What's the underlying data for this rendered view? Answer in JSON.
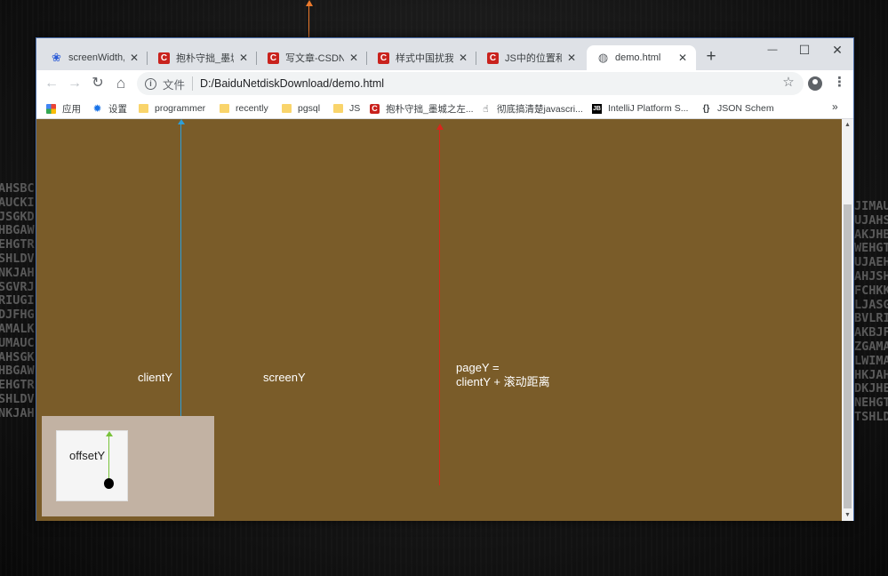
{
  "desktop": {
    "left_letters": [
      "AHSBC",
      "AUCKI",
      "JSGKD",
      "HBGAW",
      "EHGTR",
      "SHLDV",
      "NKJAH",
      "SGVRJ",
      "RIUGI",
      "DJFHG",
      "AMALK",
      "UMAUC",
      "AHSGK",
      "HBGAW",
      "EHGTR",
      "SHLDV",
      "NKJAH"
    ],
    "right_letters": [
      "JIMAU",
      "UJAHS",
      "AKJHB",
      "WEHGT",
      "UJAEH",
      "AHJSH",
      "FCHKK",
      "LJASG",
      "BVLRI",
      "AKBJF",
      "ZGAMA",
      "LWIMA",
      "HKJAH",
      "DKJHE",
      "NEHGT",
      "TSHLD"
    ]
  },
  "browser": {
    "tabs": [
      {
        "title": "screenWidth,cl",
        "icon": "baidu-paw-icon"
      },
      {
        "title": "抱朴守拙_墨城之",
        "icon": "csdn-icon"
      },
      {
        "title": "写文章-CSDN博",
        "icon": "csdn-icon"
      },
      {
        "title": "样式中国扰我们",
        "icon": "csdn-icon"
      },
      {
        "title": "JS中的位置和宽",
        "icon": "csdn-icon"
      },
      {
        "title": "demo.html",
        "icon": "globe-icon"
      }
    ],
    "close_glyph": "✕",
    "new_tab_glyph": "+",
    "window_controls": {
      "minimize": "—",
      "maximize": "☐",
      "close": "✕"
    },
    "nav": {
      "back": "←",
      "forward": "→",
      "reload": "↻",
      "home": "⌂"
    },
    "omnibox": {
      "info_glyph": "i",
      "scheme": "文件",
      "url": "D:/BaiduNetdiskDownload/demo.html"
    },
    "star_glyph": "☆",
    "menu_glyph": "⋮",
    "bookmarks": [
      {
        "label": "应用",
        "icon": "apps-icon"
      },
      {
        "label": "设置",
        "icon": "gear-icon"
      },
      {
        "label": "programmer",
        "icon": "folder-icon"
      },
      {
        "label": "recently",
        "icon": "folder-icon"
      },
      {
        "label": "pgsql",
        "icon": "folder-icon"
      },
      {
        "label": "JS",
        "icon": "folder-icon"
      },
      {
        "label": "抱朴守拙_墨城之左...",
        "icon": "csdn-icon"
      },
      {
        "label": "彻底搞清楚javascri...",
        "icon": "hand-icon"
      },
      {
        "label": "IntelliJ Platform S...",
        "icon": "jetbrains-icon"
      },
      {
        "label": "JSON Schem",
        "icon": "json-icon"
      }
    ],
    "bookmarks_more": "»"
  },
  "page": {
    "background": "#7a5c29",
    "labels": {
      "clientY": "clientY",
      "screenY": "screenY",
      "pageY_line1": "pageY =",
      "pageY_line2": "clientY + 滚动距离",
      "offsetY": "offsetY"
    },
    "arrow_colors": {
      "clientY": "#2d9fd9",
      "screenY": "#ec7a2c",
      "pageY": "#d8261c",
      "offsetY": "#78c23a"
    }
  },
  "scrollbar": {
    "up": "▲",
    "down": "▼"
  }
}
